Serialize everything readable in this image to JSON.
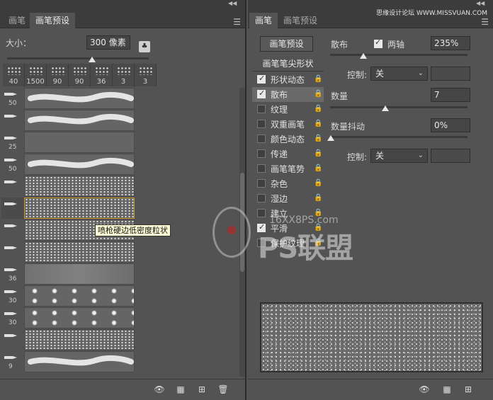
{
  "left": {
    "tabs": [
      "画笔",
      "画笔预设"
    ],
    "size_label": "大小：",
    "size_value": "300 像素",
    "size_fraction": 0.6,
    "tips": [
      "40",
      "1500",
      "90",
      "90",
      "36",
      "3",
      "3"
    ],
    "rows": [
      {
        "num": "50",
        "style": "stroke",
        "selected": false
      },
      {
        "num": "",
        "style": "stroke",
        "selected": false
      },
      {
        "num": "25",
        "style": "blank",
        "selected": false
      },
      {
        "num": "50",
        "style": "stroke",
        "selected": false
      },
      {
        "num": "",
        "style": "spray",
        "selected": false
      },
      {
        "num": "",
        "style": "spray",
        "selected": true
      },
      {
        "num": "",
        "style": "spray",
        "selected": false
      },
      {
        "num": "",
        "style": "spray",
        "selected": false
      },
      {
        "num": "36",
        "style": "faint",
        "selected": false
      },
      {
        "num": "30",
        "style": "bokeh",
        "selected": false
      },
      {
        "num": "30",
        "style": "bokeh",
        "selected": false
      },
      {
        "num": "",
        "style": "spray",
        "selected": false
      },
      {
        "num": "9",
        "style": "stroke",
        "selected": false
      }
    ],
    "tooltip": "喷枪硬边低密度粒状"
  },
  "right": {
    "tabs": [
      "画笔",
      "画笔预设"
    ],
    "preset_button": "画笔预设",
    "tip_shape_header": "画笔笔尖形状",
    "options": [
      {
        "label": "形状动态",
        "checked": true,
        "active": false
      },
      {
        "label": "散布",
        "checked": true,
        "active": true
      },
      {
        "label": "纹理",
        "checked": false,
        "active": false
      },
      {
        "label": "双重画笔",
        "checked": false,
        "active": false
      },
      {
        "label": "颜色动态",
        "checked": false,
        "active": false
      },
      {
        "label": "传递",
        "checked": false,
        "active": false
      },
      {
        "label": "画笔笔势",
        "checked": false,
        "active": false
      },
      {
        "label": "杂色",
        "checked": false,
        "active": false
      },
      {
        "label": "湿边",
        "checked": false,
        "active": false
      },
      {
        "label": "建立",
        "checked": false,
        "active": false
      },
      {
        "label": "平滑",
        "checked": true,
        "active": false
      },
      {
        "label": "保护纹理",
        "checked": false,
        "active": false
      }
    ],
    "scatter_label": "散布",
    "both_axes_label": "两轴",
    "scatter_value": "235%",
    "control_label": "控制:",
    "control_value": "关",
    "count_label": "数量",
    "count_value": "7",
    "count_jitter_label": "数量抖动",
    "count_jitter_value": "0%",
    "control2_label": "控制:",
    "control2_value": "关"
  },
  "watermark": {
    "site_top": "思缘设计论坛 WWW.MISSVUAN.COM",
    "logo_text": "PS联盟",
    "logo_domain": "16XX8PS.com"
  },
  "icons": {
    "eye": "eye-icon",
    "grid": "grid-icon",
    "new": "new-icon",
    "trash": "trash-icon"
  }
}
